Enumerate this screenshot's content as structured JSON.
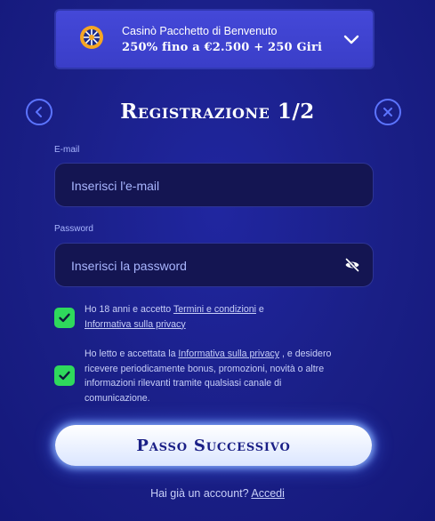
{
  "bonus": {
    "title": "Casinò Pacchetto di Benvenuto",
    "offer": "250% fino a €2.500 + 250 Giri",
    "icon": "wheel-icon",
    "chevron_icon": "chevron-down-icon"
  },
  "header": {
    "title": "Registrazione 1/2",
    "back_icon": "chevron-left-icon",
    "close_icon": "close-icon"
  },
  "form": {
    "email": {
      "label": "E-mail",
      "placeholder": "Inserisci l'e-mail",
      "value": ""
    },
    "password": {
      "label": "Password",
      "placeholder": "Inserisci la password",
      "value": "",
      "toggle_icon": "eye-off-icon"
    }
  },
  "consents": [
    {
      "checked": true,
      "text_before": "Ho 18 anni e accetto ",
      "link1": "Termini e condizioni",
      "text_middle": " e ",
      "link2": "Informativa sulla privacy"
    },
    {
      "checked": true,
      "text_before": "Ho letto e accettata la ",
      "link1": "Informativa sulla privacy",
      "text_after": " , e desidero ricevere periodicamente bonus, promozioni, novità o altre informazioni rilevanti tramite qualsiasi canale di comunicazione."
    }
  ],
  "next_button": {
    "label": "Passo Successivo"
  },
  "login": {
    "prompt": "Hai già un account?",
    "link": "Accedi"
  },
  "colors": {
    "background": "#1a1f86",
    "banner": "#3a3ecc",
    "field_bg": "#141552",
    "accent_blue": "#5c74ff",
    "checkbox_green": "#2fd95c",
    "label_blue": "#a9b6ff"
  }
}
